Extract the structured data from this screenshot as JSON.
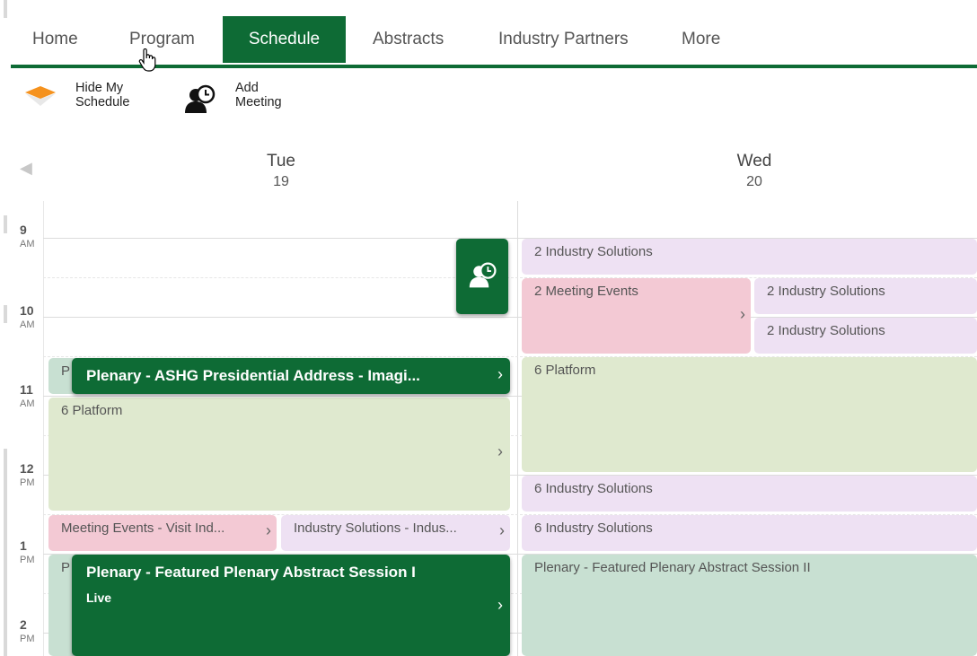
{
  "nav": {
    "items": [
      {
        "label": "Home"
      },
      {
        "label": "Program"
      },
      {
        "label": "Schedule"
      },
      {
        "label": "Abstracts"
      },
      {
        "label": "Industry Partners"
      },
      {
        "label": "More"
      }
    ]
  },
  "toolbar": {
    "hide_line1": "Hide My",
    "hide_line2": "Schedule",
    "add_line1": "Add",
    "add_line2": "Meeting"
  },
  "days": [
    {
      "name": "Tue",
      "num": "19"
    },
    {
      "name": "Wed",
      "num": "20"
    }
  ],
  "times": [
    {
      "hour": "9",
      "ampm": "AM"
    },
    {
      "hour": "10",
      "ampm": "AM"
    },
    {
      "hour": "11",
      "ampm": "AM"
    },
    {
      "hour": "12",
      "ampm": "PM"
    },
    {
      "hour": "1",
      "ampm": "PM"
    },
    {
      "hour": "2",
      "ampm": "PM"
    }
  ],
  "tue_events": {
    "plenary_behind_1": "P",
    "platform": "6 Platform",
    "meeting_visit": "Meeting Events - Visit Ind...",
    "industry_sol": "Industry Solutions - Indus...",
    "plenary_behind_2": "P"
  },
  "wed_events": {
    "ind1": "2 Industry Solutions",
    "meeting": "2 Meeting Events",
    "ind2": "2 Industry Solutions",
    "ind3": "2 Industry Solutions",
    "platform": "6 Platform",
    "ind4": "6 Industry Solutions",
    "ind5": "6 Industry Solutions",
    "plenary": "Plenary - Featured Plenary Abstract Session II"
  },
  "popups": {
    "presidential": "Plenary - ASHG Presidential Address - Imagi...",
    "featured": "Plenary - Featured Plenary Abstract Session I",
    "featured_status": "Live"
  },
  "icons": {
    "chevron": "›",
    "prev": "◀"
  },
  "colors": {
    "brand": "#0e6b35",
    "orange": "#f5921e"
  }
}
